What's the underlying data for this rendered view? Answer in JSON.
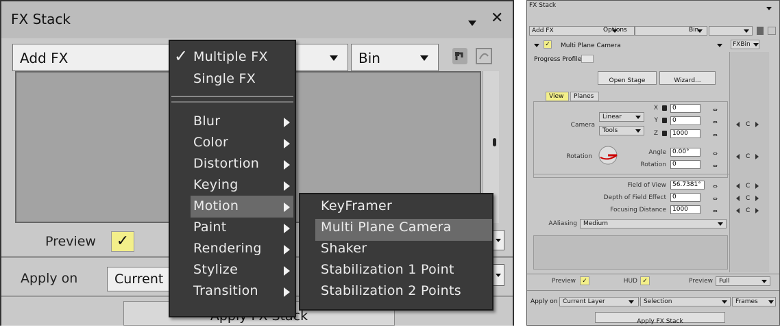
{
  "left": {
    "title": "FX Stack",
    "add_fx": "Add FX",
    "bin": "Bin",
    "preview_label": "Preview",
    "preview_checked": "✓",
    "apply_on_label": "Apply on",
    "apply_on_value": "Current",
    "apply_button": "Apply FX Stack",
    "menu": {
      "multiple": "Multiple FX",
      "multiple_check": "✓",
      "single": "Single FX",
      "items": [
        "Blur",
        "Color",
        "Distortion",
        "Keying",
        "Motion",
        "Paint",
        "Rendering",
        "Stylize",
        "Transition"
      ],
      "highlighted": "Motion"
    },
    "submenu": {
      "items": [
        "KeyFramer",
        "Multi Plane Camera",
        "Shaker",
        "Stabilization 1 Point",
        "Stabilization 2 Points"
      ],
      "highlighted": "Multi Plane Camera"
    }
  },
  "right": {
    "title": "FX Stack",
    "add_fx": "Add FX",
    "options": "Options",
    "bin": "Bin",
    "fx_name": "Multi Plane Camera",
    "fx_bin": "FXBin",
    "progress_profile": "Progress Profile",
    "open_stage": "Open Stage",
    "wizard": "Wizard...",
    "tab_view": "View",
    "tab_planes": "Planes",
    "camera_label": "Camera",
    "camera_linear": "Linear",
    "camera_tools": "Tools",
    "x_label": "X",
    "x_value": "0",
    "y_label": "Y",
    "y_value": "0",
    "z_label": "Z",
    "z_value": "1000",
    "rotation_label": "Rotation",
    "angle_label": "Angle",
    "angle_value": "0.00°",
    "rotation2_label": "Rotation",
    "rotation2_value": "0",
    "fov_label": "Field of View",
    "fov_value": "56.7381°",
    "dof_label": "Depth of Field Effect",
    "dof_value": "0",
    "focus_label": "Focusing Distance",
    "focus_value": "1000",
    "aliasing_label": "AAliasing",
    "aliasing_value": "Medium",
    "key_c": "C",
    "preview_label": "Preview",
    "hud_label": "HUD",
    "preview2_label": "Preview",
    "preview2_value": "Full",
    "apply_on_label": "Apply on",
    "current_layer": "Current Layer",
    "selection": "Selection",
    "frames": "Frames",
    "apply_button": "Apply FX Stack",
    "check": "✓"
  }
}
